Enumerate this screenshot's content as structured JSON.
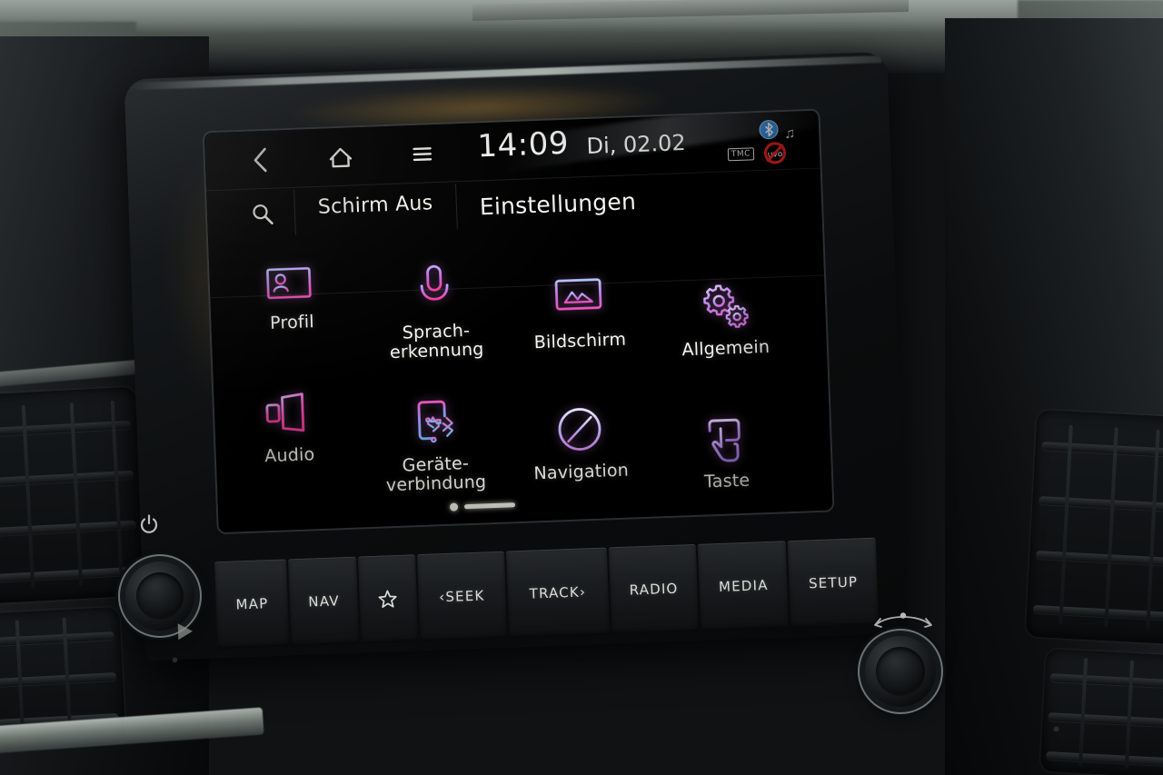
{
  "device": {
    "name": "car-infotainment-head-unit",
    "brand_system": "UVO"
  },
  "screen": {
    "topbar": {
      "back_icon": "chevron-left-icon",
      "home_icon": "home-icon",
      "menu_icon": "hamburger-menu-icon",
      "clock": "14:09",
      "date": "Di, 02.02",
      "status": {
        "bluetooth_icon": "bluetooth-audio-icon",
        "music_note_icon": "music-note-icon",
        "tmc_label": "TMC",
        "uvo_label": "uvo",
        "uvo_state": "disabled"
      }
    },
    "row2": {
      "search_icon": "search-icon",
      "screen_off_label": "Schirm Aus",
      "page_title": "Einstellungen"
    },
    "grid": {
      "items": [
        {
          "label": "Profil",
          "icon": "id-card-icon",
          "color_top": "#9fb6ff",
          "color_bottom": "#e95fd0"
        },
        {
          "label": "Sprach-\nerkennung",
          "icon": "microphone-icon",
          "color_top": "#b28bf0",
          "color_bottom": "#f0469f"
        },
        {
          "label": "Bildschirm",
          "icon": "display-monitor-icon",
          "color_top": "#aab4f5",
          "color_bottom": "#ef5bbf"
        },
        {
          "label": "Allgemein",
          "icon": "gears-settings-icon",
          "color_top": "#cdb6f7",
          "color_bottom": "#c97ae0"
        },
        {
          "label": "Audio",
          "icon": "speaker-volume-icon",
          "color_top": "#d78ef0",
          "color_bottom": "#f44aa0"
        },
        {
          "label": "Geräte-\nverbindung",
          "icon": "phone-usb-bluetooth-icon",
          "color_top": "#7ea6e8",
          "color_bottom": "#e95fd0"
        },
        {
          "label": "Navigation",
          "icon": "compass-icon",
          "color_top": "#cfd8ff",
          "color_bottom": "#b07ae0"
        },
        {
          "label": "Taste",
          "icon": "hand-press-button-icon",
          "color_top": "#d9c6ff",
          "color_bottom": "#b58ae8"
        }
      ],
      "pagination": {
        "current_page": 1,
        "total_pages": 2
      }
    }
  },
  "hard_buttons": [
    {
      "label": "MAP"
    },
    {
      "label": "NAV"
    },
    {
      "label": "",
      "icon": "star-favorite-icon"
    },
    {
      "label": "‹SEEK"
    },
    {
      "label": "TRACK›"
    },
    {
      "label": "RADIO"
    },
    {
      "label": "MEDIA"
    },
    {
      "label": "SETUP"
    }
  ],
  "knobs": {
    "left": {
      "name": "power-volume-knob",
      "icon": "power-icon"
    },
    "right": {
      "name": "tune-knob",
      "icon": "rotate-arrows-icon"
    }
  },
  "colors": {
    "screen_background": "#000000",
    "ui_text": "#f2f3ef",
    "accent_pink": "#ef4fa8",
    "accent_purple": "#b07ae0",
    "accent_blue": "#8fa9f0",
    "uvo_red": "#e02020",
    "bluetooth_blue": "#2a7fd4"
  }
}
